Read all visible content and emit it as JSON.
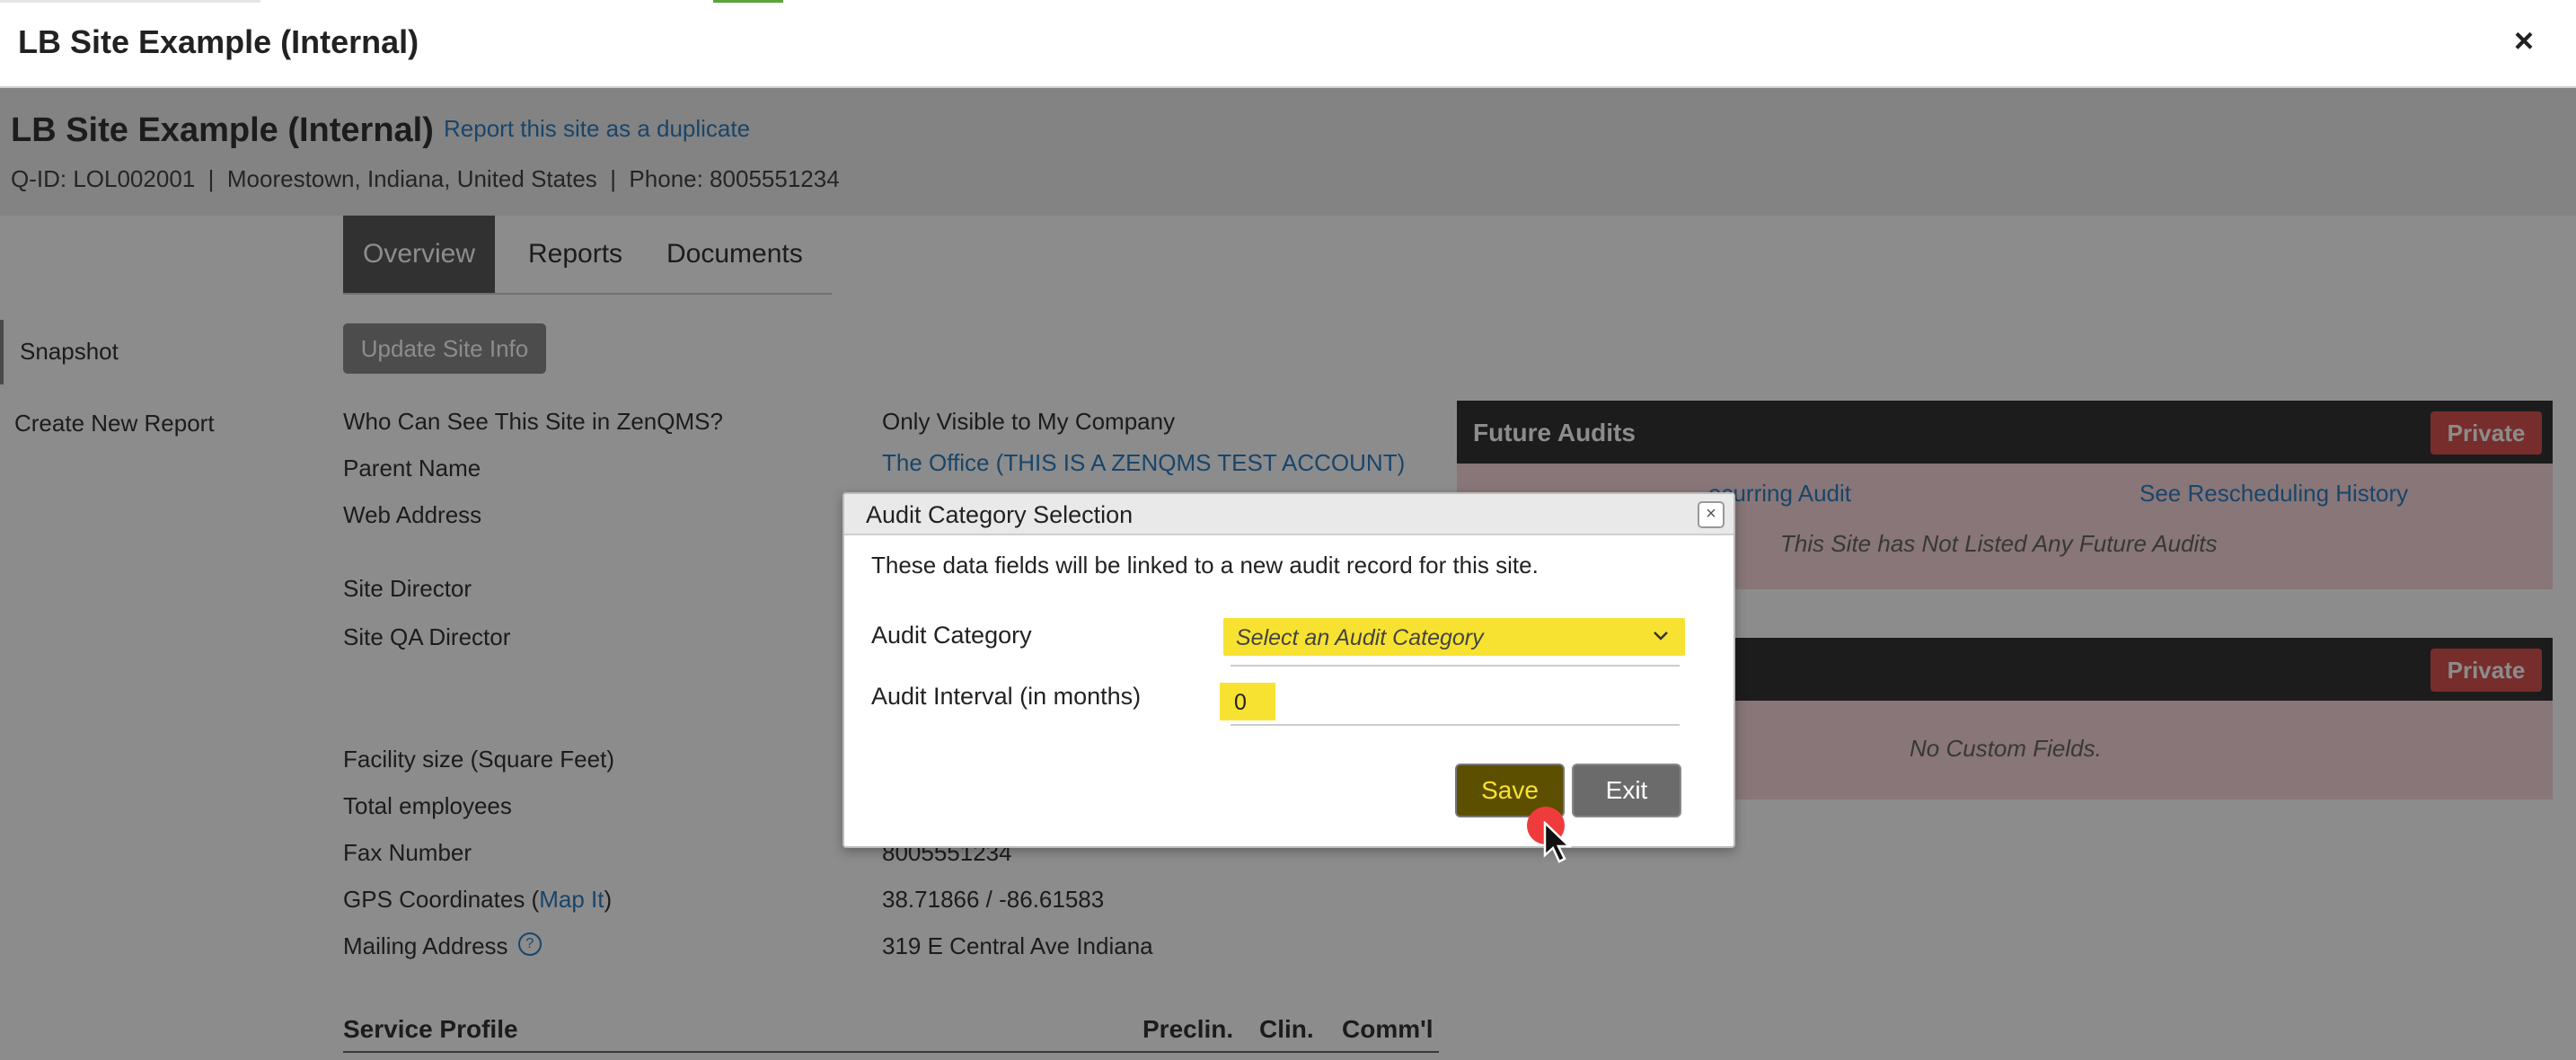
{
  "window": {
    "title": "LB Site Example (Internal)",
    "close_icon": "close-icon",
    "close_glyph": "×"
  },
  "site": {
    "name": "LB Site Example (Internal)",
    "duplicate_link": "Report this site as a duplicate",
    "meta": "Q-ID: LOL002001  |  Moorestown, Indiana, United States  |  Phone: 8005551234"
  },
  "tabs": [
    {
      "label": "Overview",
      "active": true
    },
    {
      "label": "Reports",
      "active": false
    },
    {
      "label": "Documents",
      "active": false
    }
  ],
  "sidebar": {
    "items": [
      {
        "label": "Snapshot",
        "active": true
      },
      {
        "label": "Create New Report",
        "active": false
      }
    ]
  },
  "update_button": "Update Site Info",
  "fields": [
    {
      "label": "Who Can See This Site in ZenQMS?",
      "value": "Only Visible to My Company"
    },
    {
      "label": "Parent Name",
      "value": "The Office (THIS IS A ZENQMS TEST ACCOUNT)"
    },
    {
      "label": "Web Address",
      "value": ""
    },
    {
      "label": "Site Director",
      "value": ""
    },
    {
      "label": "Site QA Director",
      "value": ""
    },
    {
      "label": "Facility size (Square Feet)",
      "value": ""
    },
    {
      "label": "Total employees",
      "value": ""
    },
    {
      "label": "Fax Number",
      "value": "8005551234"
    },
    {
      "label": "GPS Coordinates (Map It)",
      "value": "38.71866 / -86.61583"
    },
    {
      "label": "Mailing Address",
      "value": "319 E Central Ave Indiana"
    }
  ],
  "gps": {
    "prefix": "GPS Coordinates (",
    "link": "Map It",
    "suffix": ")"
  },
  "help_icon": "question-circle-icon",
  "service_profile": {
    "title": "Service Profile",
    "columns": [
      "Preclin.",
      "Clin.",
      "Comm'l"
    ]
  },
  "panels": {
    "future_audits": {
      "title": "Future Audits",
      "badge": "Private",
      "link_left": "ecurring Audit",
      "link_right": "See Rescheduling History",
      "empty": "This Site has Not Listed Any Future Audits"
    },
    "custom_fields": {
      "title": "",
      "badge": "Private",
      "empty": "No Custom Fields."
    }
  },
  "dialog": {
    "title": "Audit Category Selection",
    "close_glyph": "×",
    "note": "These data fields will be linked to a new audit record for this site.",
    "category_label": "Audit Category",
    "category_placeholder": "Select an Audit Category",
    "interval_label": "Audit Interval (in months)",
    "interval_value": "0",
    "save": "Save",
    "exit": "Exit"
  },
  "colors": {
    "highlight": "#f8e231",
    "private_badge": "#d9534f",
    "link": "#2f7fc1",
    "click_indicator": "#ef3b3b"
  }
}
